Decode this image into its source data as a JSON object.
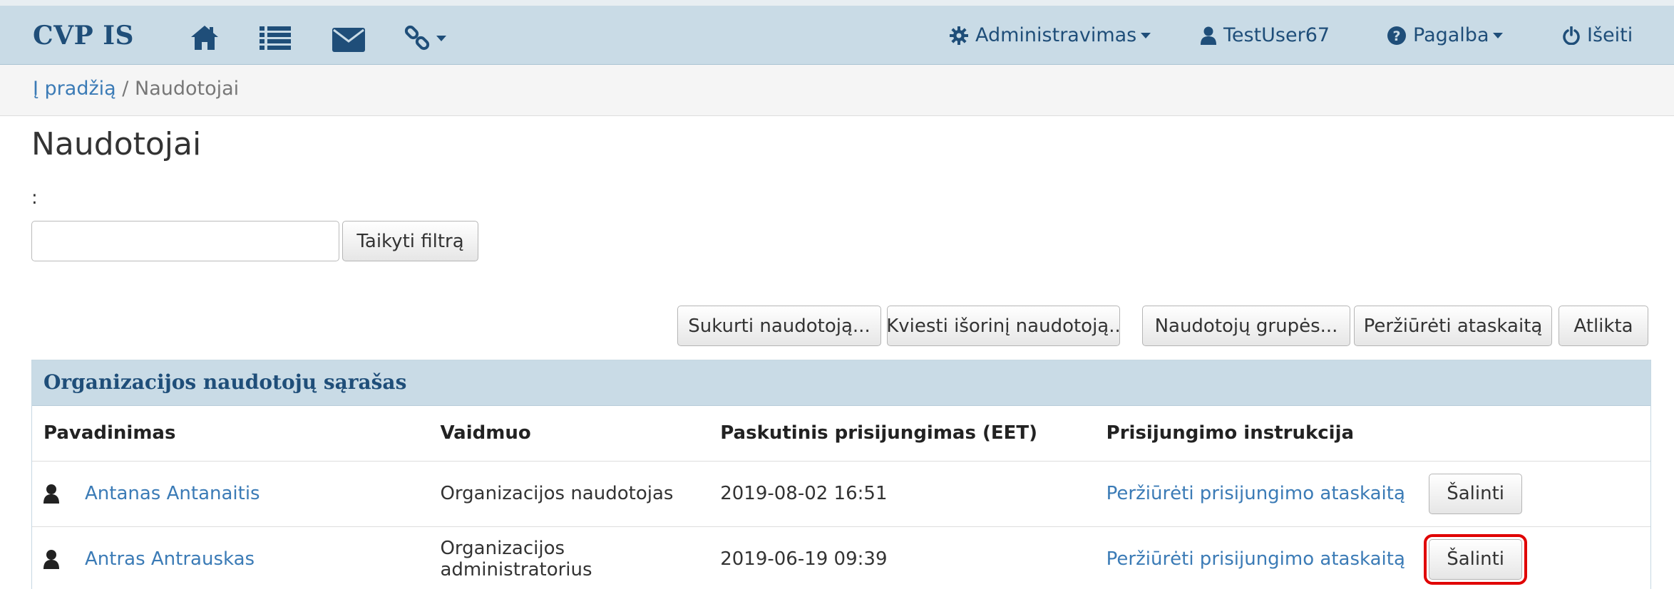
{
  "navbar": {
    "brand": "CVP IS",
    "icons": [
      "home-icon",
      "list-icon",
      "envelope-icon",
      "link-icon"
    ],
    "admin_label": "Administravimas",
    "user_label": "TestUser67",
    "help_label": "Pagalba",
    "logout_label": "Išeiti"
  },
  "breadcrumb": {
    "home": "Į pradžią",
    "separator": "/",
    "current": "Naudotojai"
  },
  "page": {
    "title": "Naudotojai",
    "filter_label": ":",
    "filter_value": "",
    "filter_button": "Taikyti filtrą"
  },
  "actions": {
    "create": "Sukurti naudotoją...",
    "invite": "Kviesti išorinį naudotoją..",
    "groups": "Naudotojų grupės...",
    "report": "Peržiūrėti ataskaitą",
    "done": "Atlikta"
  },
  "panel": {
    "title": "Organizacijos naudotojų sąrašas",
    "columns": [
      "Pavadinimas",
      "Vaidmuo",
      "Paskutinis prisijungimas (EET)",
      "Prisijungimo instrukcija"
    ],
    "rows": [
      {
        "name": "Antanas Antanaitis",
        "role": "Organizacijos naudotojas",
        "last_login": "2019-08-02 16:51",
        "instruction": "Peržiūrėti prisijungimo ataskaitą",
        "delete": "Šalinti"
      },
      {
        "name": "Antras Antrauskas",
        "role": "Organizacijos administratorius",
        "last_login": "2019-06-19 09:39",
        "instruction": "Peržiūrėti prisijungimo ataskaitą",
        "delete": "Šalinti"
      }
    ]
  },
  "colors": {
    "navbar_bg": "#c9dbe6",
    "brand": "#1f4e79",
    "link": "#3b7bb6",
    "highlight": "#e00000"
  }
}
